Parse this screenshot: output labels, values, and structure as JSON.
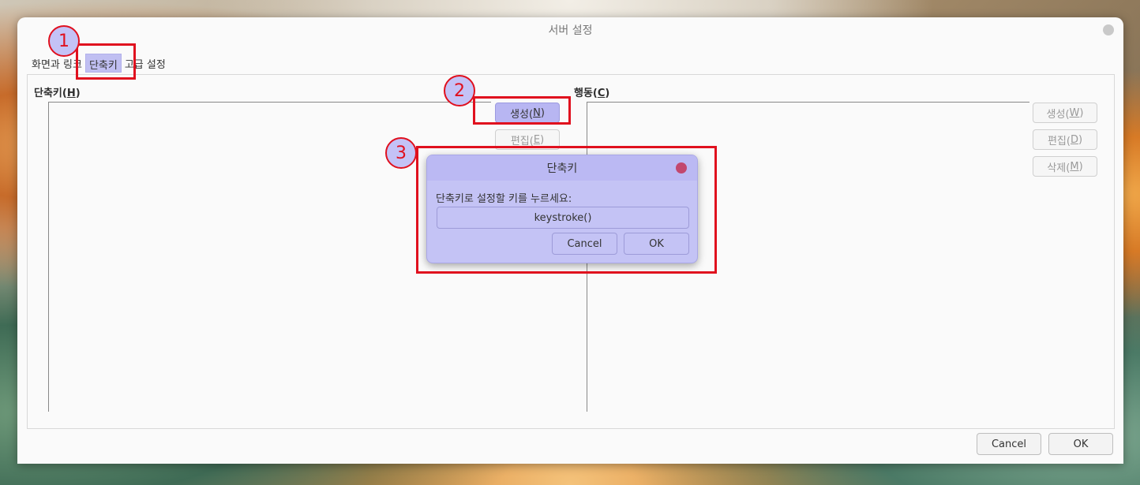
{
  "window": {
    "title": "서버 설정",
    "tabs": [
      "화면과 링크",
      "단축키",
      "고급 설정"
    ],
    "active_tab": "단축키"
  },
  "shortcuts": {
    "label": "단축키(",
    "label_key": "H",
    "label_end": ")",
    "buttons": {
      "create": {
        "text": "생성(",
        "key": "N",
        "end": ")"
      },
      "edit": {
        "text": "편집(",
        "key": "E",
        "end": ")"
      }
    }
  },
  "actions": {
    "label": "행동(",
    "label_key": "C",
    "label_end": ")",
    "buttons": {
      "create": {
        "text": "생성(",
        "key": "W",
        "end": ")"
      },
      "edit": {
        "text": "편집(",
        "key": "D",
        "end": ")"
      },
      "delete": {
        "text": "삭제(",
        "key": "M",
        "end": ")"
      }
    }
  },
  "dialog": {
    "title": "단축키",
    "prompt": "단축키로 설정할 키를 누르세요:",
    "key_value": "keystroke()",
    "cancel": "Cancel",
    "ok": "OK"
  },
  "footer": {
    "cancel": "Cancel",
    "ok": "OK"
  },
  "annotations": [
    "1",
    "2",
    "3"
  ],
  "colors": {
    "highlight": "#c0bff2",
    "annotation_red": "#e0101e",
    "dialog_close": "#c2476e"
  }
}
